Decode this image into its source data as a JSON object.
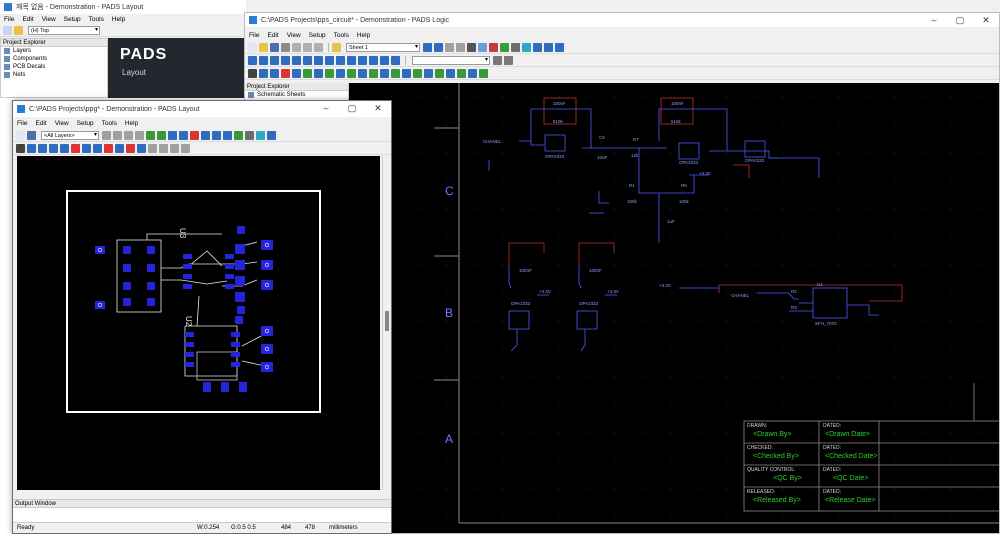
{
  "layout_win": {
    "title": "제목 없음 - Demonstration - PADS Layout",
    "menu": [
      "File",
      "Edit",
      "View",
      "Setup",
      "Tools",
      "Help"
    ],
    "layer_combo": "(H) Top",
    "explorer_title": "Project Explorer",
    "tree": [
      "Layers",
      "Components",
      "PCB Decals",
      "Nets"
    ],
    "splash_logo": "PADS",
    "splash_sub": "Layout"
  },
  "logic_win": {
    "title": "C:\\PADS Projects\\pps_circuit* - Demonstration - PADS Logic",
    "menu": [
      "File",
      "Edit",
      "View",
      "Setup",
      "Tools",
      "Help"
    ],
    "sheet_combo": "Sheet 1",
    "explorer_title": "Project Explorer",
    "explorer_item": "Schematic Sheets",
    "row_labels": [
      "C",
      "B",
      "A"
    ],
    "title_block": [
      {
        "label": "DRAWN:",
        "value": "<Drawn By>",
        "dlabel": "DATED:",
        "dvalue": "<Drawn Date>"
      },
      {
        "label": "CHECKED:",
        "value": "<Checked By>",
        "dlabel": "DATED:",
        "dvalue": "<Checked Date>"
      },
      {
        "label": "QUALITY CONTROL:",
        "value": "<QC By>",
        "dlabel": "DATED:",
        "dvalue": "<QC Date>"
      },
      {
        "label": "RELEASED:",
        "value": "<Released By>",
        "dlabel": "DATED:",
        "dvalue": "<Release Date>"
      }
    ],
    "schematic_labels": {
      "chanel1": "CHANEL",
      "chanel2": "CHANEL",
      "c100nf1": "100nF",
      "c100nf2": "100nF",
      "c10uf": "10uF",
      "c1uf": "1uF",
      "c6": "C6",
      "r510k1": "510k",
      "r510k2": "510k",
      "r12k": "12k",
      "r100k1": "100k",
      "r100k2": "100k",
      "r7": "R7",
      "r1": "R1",
      "r6": "R6",
      "opa1": "OPA2333",
      "opa2": "OPA2333",
      "opa3": "OPA2333",
      "opa4": "OPA2333",
      "opa5": "OPA2333",
      "v33a": "+3.3V",
      "v33b": "+3.3V",
      "v33c": "+3.3V",
      "v33d": "+3.3V",
      "sfh": "SFH_7070",
      "u1": "U1",
      "r2": "R2",
      "r3": "R3",
      "rk": "2k",
      "x1": "K",
      "x2": "K"
    }
  },
  "pps_win": {
    "title": "C:\\PADS Projects\\ppg* - Demonstration - PADS Layout",
    "menu": [
      "File",
      "Edit",
      "View",
      "Setup",
      "Tools",
      "Help"
    ],
    "layers_combo": "<All Layers>",
    "refdes_u3": "U3",
    "refdes_u2": "U2",
    "output_window": "Output Window",
    "status": {
      "ready": "Ready",
      "width": "W:0.254",
      "grid": "G:0.5 0.5",
      "x": "484",
      "y": "478",
      "units": "millimeters"
    }
  },
  "colors": {
    "pad": "#2424d8",
    "board": "#ffffff",
    "wire": "#5a6cff",
    "net_red": "#c03030",
    "title_green": "#2ad22a"
  }
}
